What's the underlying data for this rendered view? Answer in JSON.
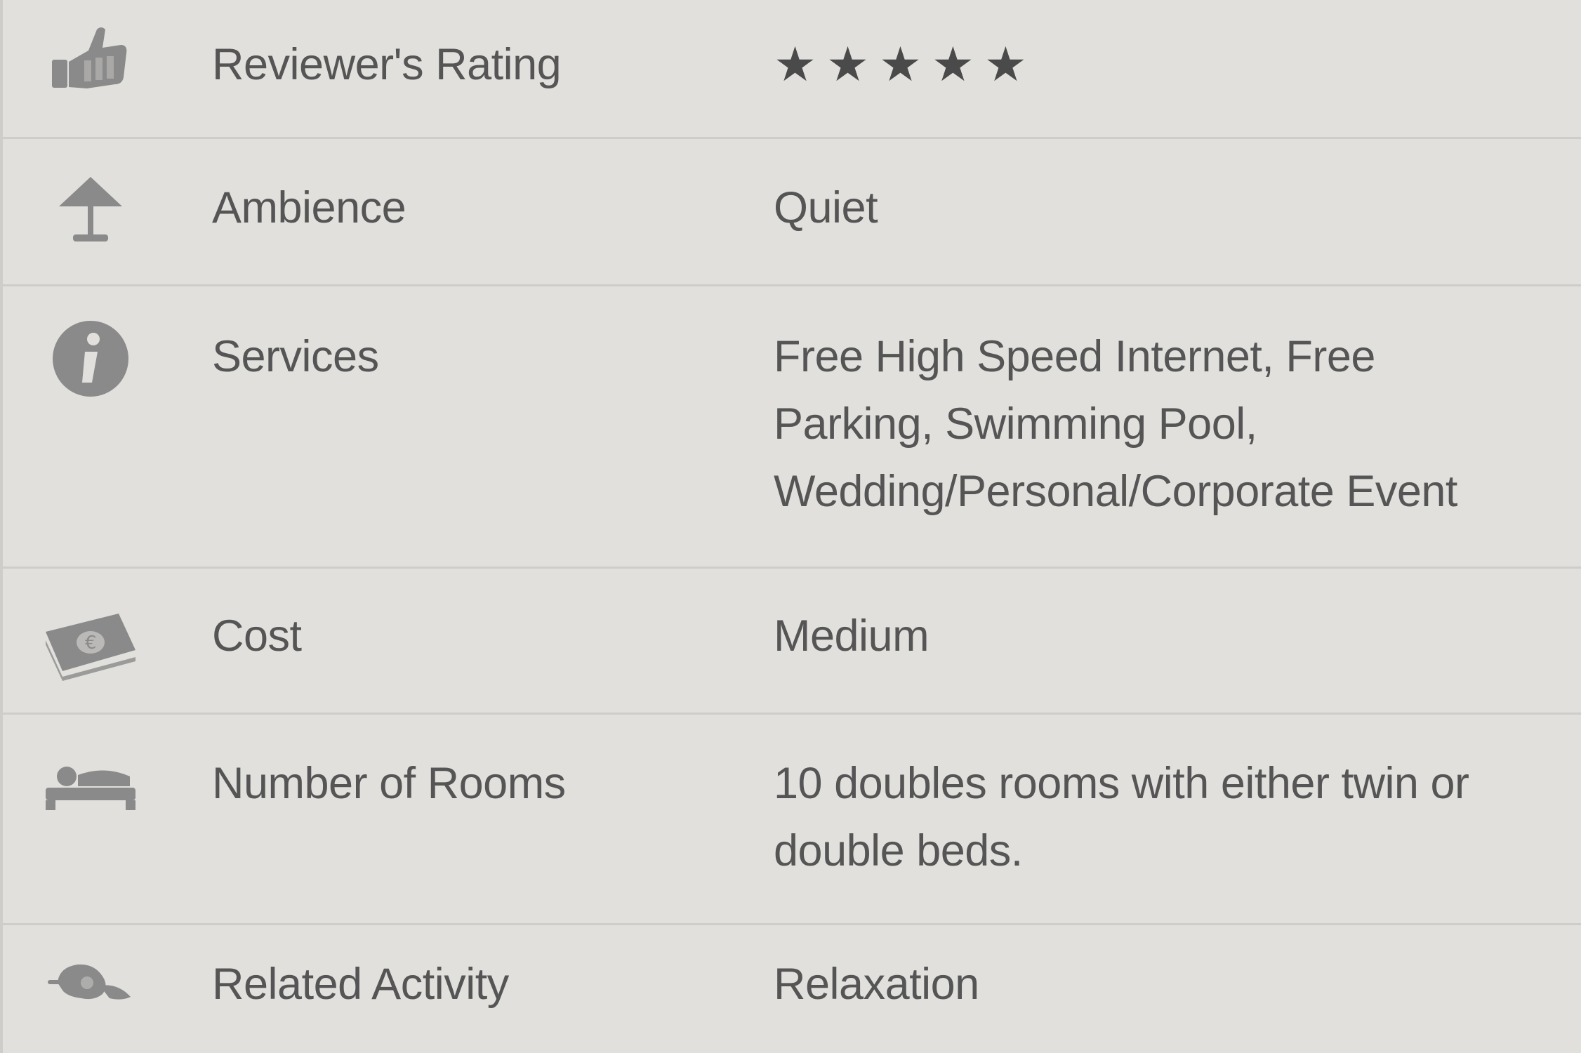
{
  "rows": [
    {
      "label": "Reviewer's Rating",
      "icon": "thumbs-up-icon",
      "rating": 5,
      "star_glyph": "★"
    },
    {
      "label": "Ambience",
      "icon": "lamp-icon",
      "value": "Quiet"
    },
    {
      "label": "Services",
      "icon": "info-icon",
      "value": "Free High Speed Internet, Free Parking, Swimming Pool, Wedding/Personal/Corporate Event"
    },
    {
      "label": "Cost",
      "icon": "money-icon",
      "value": "Medium"
    },
    {
      "label": "Number of Rooms",
      "icon": "bed-icon",
      "value": "10 doubles rooms with either twin or double beds."
    },
    {
      "label": "Related Activity",
      "icon": "relaxation-icon",
      "value": "Relaxation"
    }
  ],
  "colors": {
    "background": "#e1e0dd",
    "text": "#555555",
    "divider": "#cfcdca",
    "icon": "#8a8a8a"
  }
}
